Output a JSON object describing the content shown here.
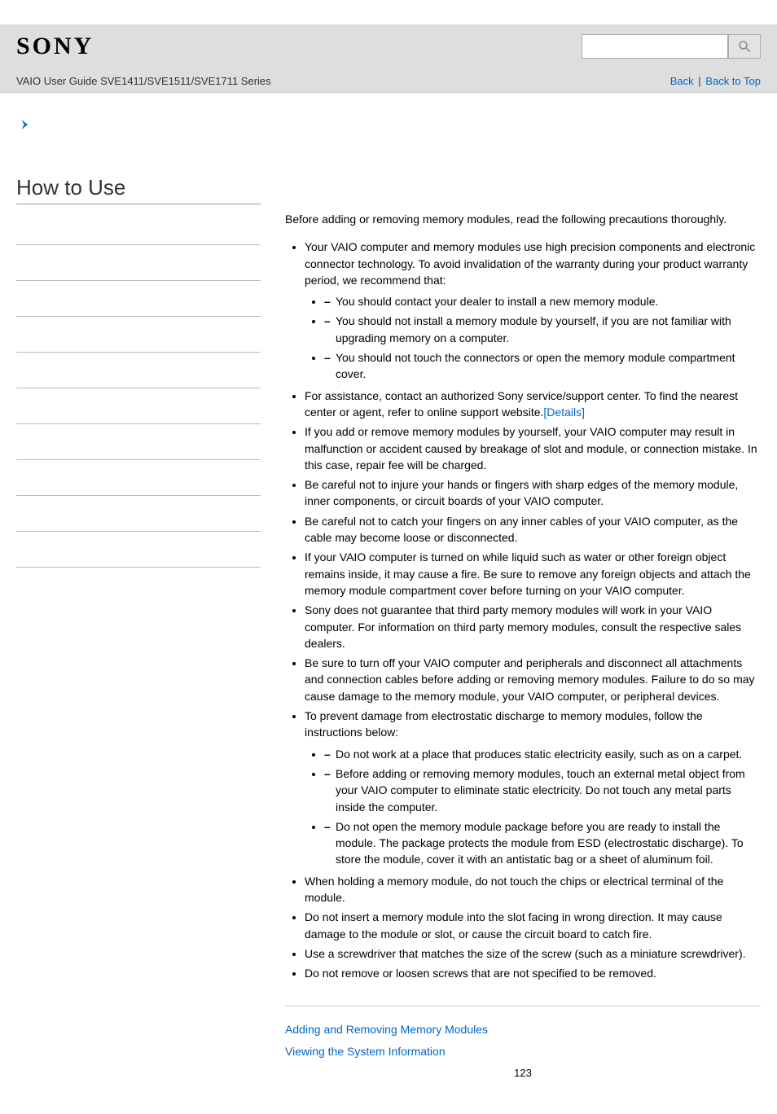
{
  "header": {
    "logo": "SONY",
    "subtitle": "VAIO User Guide SVE1411/SVE1511/SVE1711 Series",
    "search_placeholder": "",
    "back_label": "Back",
    "back_to_top_label": "Back to Top",
    "separator": "|"
  },
  "sidebar": {
    "title": "How to Use",
    "row_count": 10
  },
  "main": {
    "intro": "Before adding or removing memory modules, read the following precautions thoroughly.",
    "bullets": [
      {
        "text": "Your VAIO computer and memory modules use high precision components and electronic connector technology. To avoid invalidation of the warranty during your product warranty period, we recommend that:",
        "sub": [
          "You should contact your dealer to install a new memory module.",
          "You should not install a memory module by yourself, if you are not familiar with upgrading memory on a computer.",
          "You should not touch the connectors or open the memory module compartment cover."
        ]
      },
      {
        "text": "For assistance, contact an authorized Sony service/support center. To find the nearest center or agent, refer to online support website.",
        "link": "[Details]"
      },
      {
        "text": "If you add or remove memory modules by yourself, your VAIO computer may result in malfunction or accident caused by breakage of slot and module, or connection mistake. In this case, repair fee will be charged."
      },
      {
        "text": "Be careful not to injure your hands or fingers with sharp edges of the memory module, inner components, or circuit boards of your VAIO computer."
      },
      {
        "text": "Be careful not to catch your fingers on any inner cables of your VAIO computer, as the cable may become loose or disconnected."
      },
      {
        "text": "If your VAIO computer is turned on while liquid such as water or other foreign object remains inside, it may cause a fire. Be sure to remove any foreign objects and attach the memory module compartment cover before turning on your VAIO computer."
      },
      {
        "text": "Sony does not guarantee that third party memory modules will work in your VAIO computer. For information on third party memory modules, consult the respective sales dealers."
      },
      {
        "text": "Be sure to turn off your VAIO computer and peripherals and disconnect all attachments and connection cables before adding or removing memory modules. Failure to do so may cause damage to the memory module, your VAIO computer, or peripheral devices."
      },
      {
        "text": "To prevent damage from electrostatic discharge to memory modules, follow the instructions below:",
        "sub": [
          "Do not work at a place that produces static electricity easily, such as on a carpet.",
          "Before adding or removing memory modules, touch an external metal object from your VAIO computer to eliminate static electricity. Do not touch any metal parts inside the computer.",
          "Do not open the memory module package before you are ready to install the module. The package protects the module from ESD (electrostatic discharge). To store the module, cover it with an antistatic bag or a sheet of aluminum foil."
        ]
      },
      {
        "text": "When holding a memory module, do not touch the chips or electrical terminal of the module."
      },
      {
        "text": "Do not insert a memory module into the slot facing in wrong direction. It may cause damage to the module or slot, or cause the circuit board to catch fire."
      },
      {
        "text": "Use a screwdriver that matches the size of the screw (such as a miniature screwdriver)."
      },
      {
        "text": "Do not remove or loosen screws that are not specified to be removed."
      }
    ],
    "footer_links": [
      "Adding and Removing Memory Modules",
      "Viewing the System Information"
    ],
    "page_number": "123"
  }
}
